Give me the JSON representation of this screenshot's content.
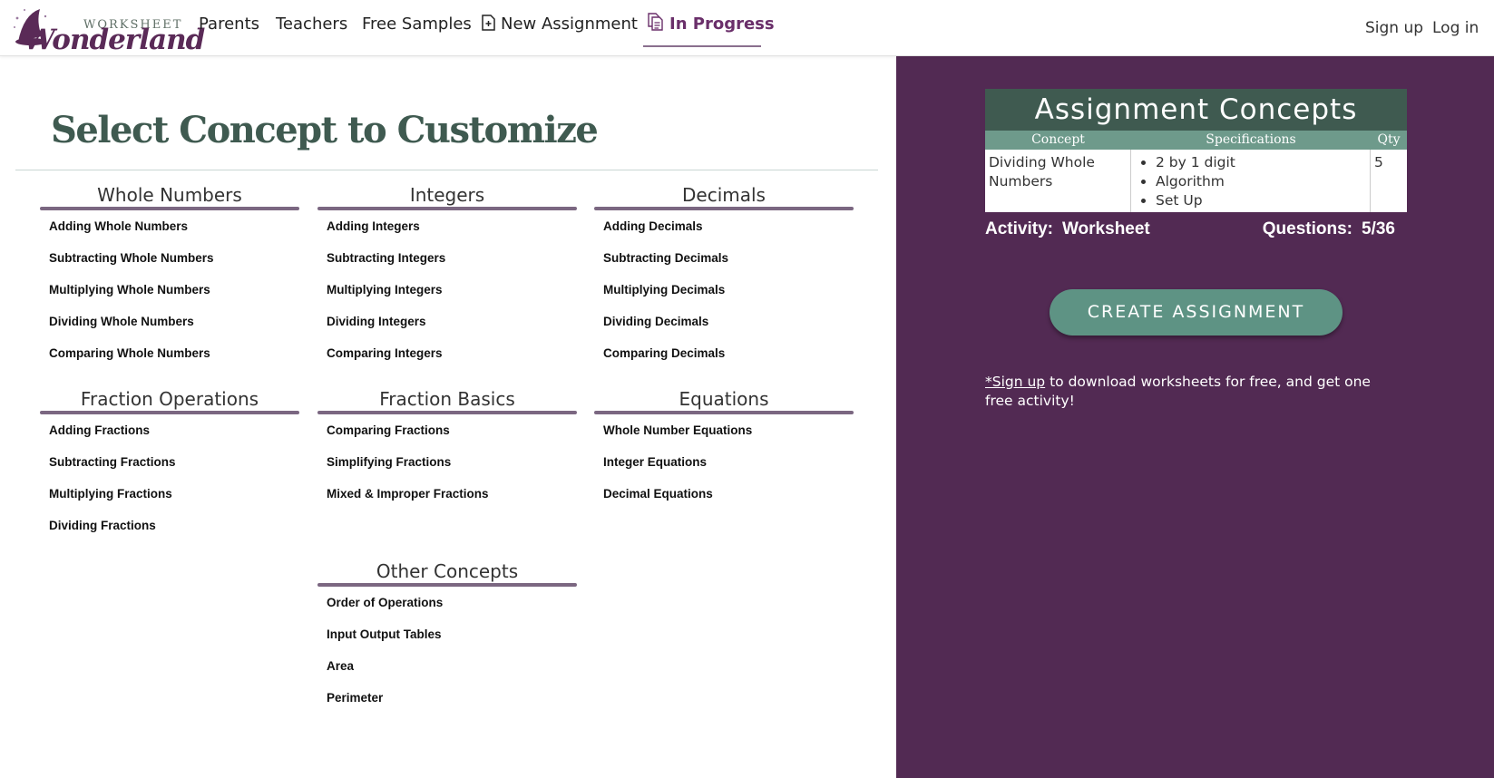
{
  "logo": {
    "small": "WORKSHEET",
    "big": "Wonderland"
  },
  "nav": {
    "parents": "Parents",
    "teachers": "Teachers",
    "free_samples": "Free Samples",
    "new_assignment": "New Assignment",
    "in_progress": "In Progress",
    "sign_up": "Sign up",
    "log_in": "Log in"
  },
  "main": {
    "title": "Select Concept to Customize",
    "groups": [
      {
        "title": "Whole Numbers",
        "items": [
          "Adding Whole Numbers",
          "Subtracting Whole Numbers",
          "Multiplying Whole Numbers",
          "Dividing Whole Numbers",
          "Comparing Whole Numbers"
        ]
      },
      {
        "title": "Integers",
        "items": [
          "Adding Integers",
          "Subtracting Integers",
          "Multiplying Integers",
          "Dividing Integers",
          "Comparing Integers"
        ]
      },
      {
        "title": "Decimals",
        "items": [
          "Adding Decimals",
          "Subtracting Decimals",
          "Multiplying Decimals",
          "Dividing Decimals",
          "Comparing Decimals"
        ]
      },
      {
        "title": "Fraction Operations",
        "items": [
          "Adding Fractions",
          "Subtracting Fractions",
          "Multiplying Fractions",
          "Dividing Fractions"
        ]
      },
      {
        "title": "Fraction Basics",
        "items": [
          "Comparing Fractions",
          "Simplifying Fractions",
          "Mixed & Improper Fractions"
        ]
      },
      {
        "title": "Equations",
        "items": [
          "Whole Number Equations",
          "Integer Equations",
          "Decimal Equations"
        ]
      },
      {
        "title": "Other Concepts",
        "items": [
          "Order of Operations",
          "Input Output Tables",
          "Area",
          "Perimeter"
        ]
      }
    ]
  },
  "sidebar": {
    "box_title": "Assignment Concepts",
    "columns": {
      "concept": "Concept",
      "specifications": "Specifications",
      "qty": "Qty"
    },
    "row": {
      "concept": "Dividing Whole Numbers",
      "specs": [
        "2 by 1 digit",
        "Algorithm",
        "Set Up"
      ],
      "qty": "5"
    },
    "activity_label": "Activity:",
    "activity_value": "Worksheet",
    "questions_label": "Questions:",
    "questions_value": "5/36",
    "create_button": "CREATE ASSIGNMENT",
    "signup_link": "*Sign up",
    "signup_text": " to download worksheets for free, and get one free activity!"
  },
  "colors": {
    "brand_purple": "#522a53",
    "brand_green": "#3f5a50",
    "button_green": "#5e9384",
    "header_cols": "#6e9a8b",
    "group_bar": "#7b6781"
  },
  "icons": {
    "new_assignment": "document-plus-icon",
    "in_progress": "documents-icon"
  }
}
